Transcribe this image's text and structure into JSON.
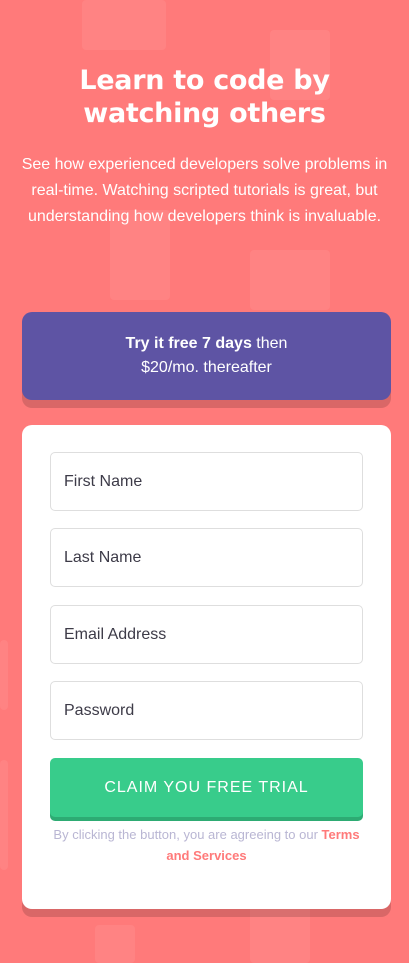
{
  "intro": {
    "title": "Learn to code by watching others",
    "description": "See how experienced developers solve problems in real-time. Watching scripted tutorials is great, but understanding how developers think is invaluable."
  },
  "promo": {
    "bold_text": "Try it free 7 days",
    "text_after_bold": "then",
    "line2": "$20/mo. thereafter"
  },
  "form": {
    "first_name_placeholder": "First Name",
    "last_name_placeholder": "Last Name",
    "email_placeholder": "Email Address",
    "password_placeholder": "Password",
    "submit_label": "CLAIM YOU FREE TRIAL",
    "terms_text": "By clicking the button, you are agreeing to our",
    "terms_link": "Terms and Services"
  },
  "colors": {
    "background": "#ff7a7a",
    "promo_bg": "#5e54a4",
    "submit_bg": "#38cc8b",
    "link": "#ff7a7a",
    "muted": "#b9b6d3"
  }
}
